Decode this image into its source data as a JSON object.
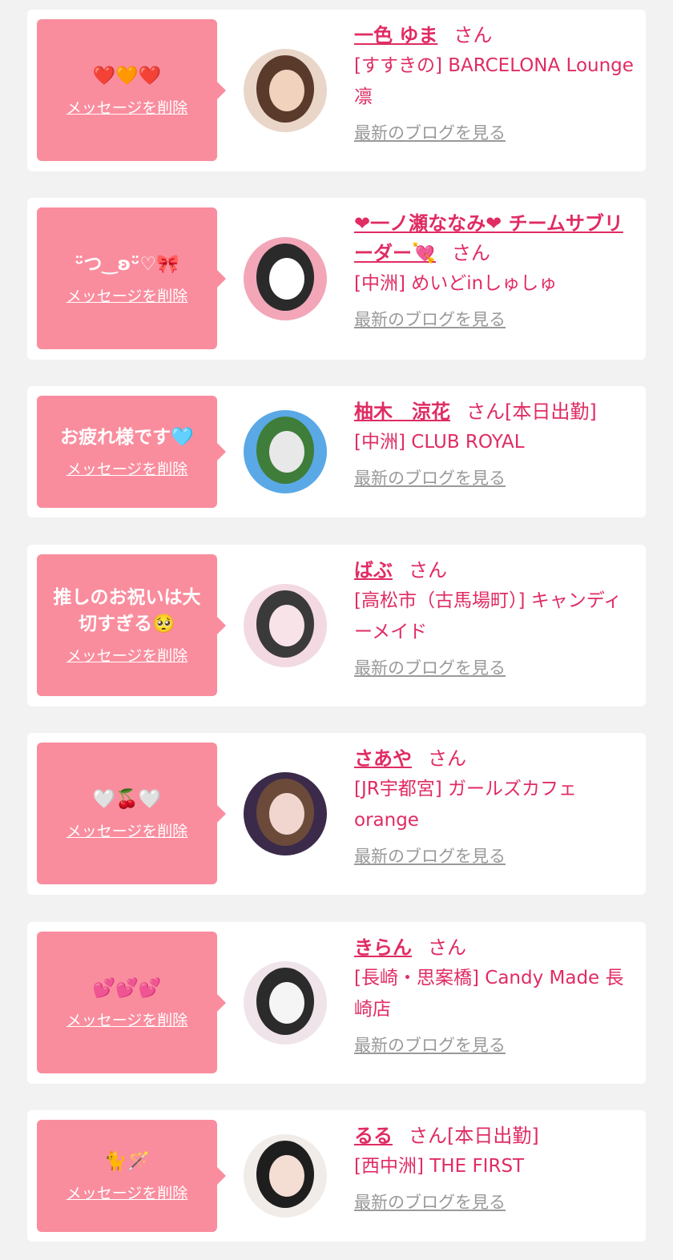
{
  "delete_label": "メッセージを削除",
  "blog_label": "最新のブログを見る",
  "san_label": "さん",
  "cards": [
    {
      "message": "❤️🧡❤️",
      "name": "一色 ゆま",
      "status": "",
      "shop": "[すすきの] BARCELONA Lounge 凛",
      "avatar_colors": [
        "#e9d6c8",
        "#5a3a2a",
        "#f1d2bd"
      ]
    },
    {
      "message": "ᵕ̈つ‿ʚᵕ̈♡🎀",
      "name": "❤一ノ瀬ななみ❤ チームサブリーダー💘",
      "status": "",
      "shop": "[中洲] めいどinしゅしゅ",
      "avatar_colors": [
        "#f2a6b8",
        "#2a2a2a",
        "#ffffff"
      ]
    },
    {
      "message": "お疲れ様です🩵",
      "name": "柚木　涼花",
      "status": "[本日出勤]",
      "shop": "[中洲] CLUB ROYAL",
      "avatar_colors": [
        "#5aa9e6",
        "#3f7d3a",
        "#e8e8e8"
      ]
    },
    {
      "message": "推しのお祝いは大切すぎる🥺",
      "name": "ばぶ",
      "status": "",
      "shop": "[高松市（古馬場町）] キャンディーメイド",
      "avatar_colors": [
        "#f3d9e2",
        "#3a3a3a",
        "#f7e3e8"
      ]
    },
    {
      "message": "🤍🍒🤍",
      "name": "さあや",
      "status": "",
      "shop": "[JR宇都宮] ガールズカフェ orange",
      "avatar_colors": [
        "#3b2a4a",
        "#6b4a3a",
        "#f0d6cf"
      ]
    },
    {
      "message": "💕💕💕",
      "name": "きらん",
      "status": "",
      "shop": "[長崎・思案橋] Candy Made 長崎店",
      "avatar_colors": [
        "#efe4ea",
        "#2b2b2b",
        "#f5f5f5"
      ]
    },
    {
      "message": "🐈🪄",
      "name": "るる",
      "status": "[本日出勤]",
      "shop": "[西中洲] THE FIRST",
      "avatar_colors": [
        "#f2ece8",
        "#1e1e1e",
        "#f4ddd3"
      ]
    }
  ]
}
